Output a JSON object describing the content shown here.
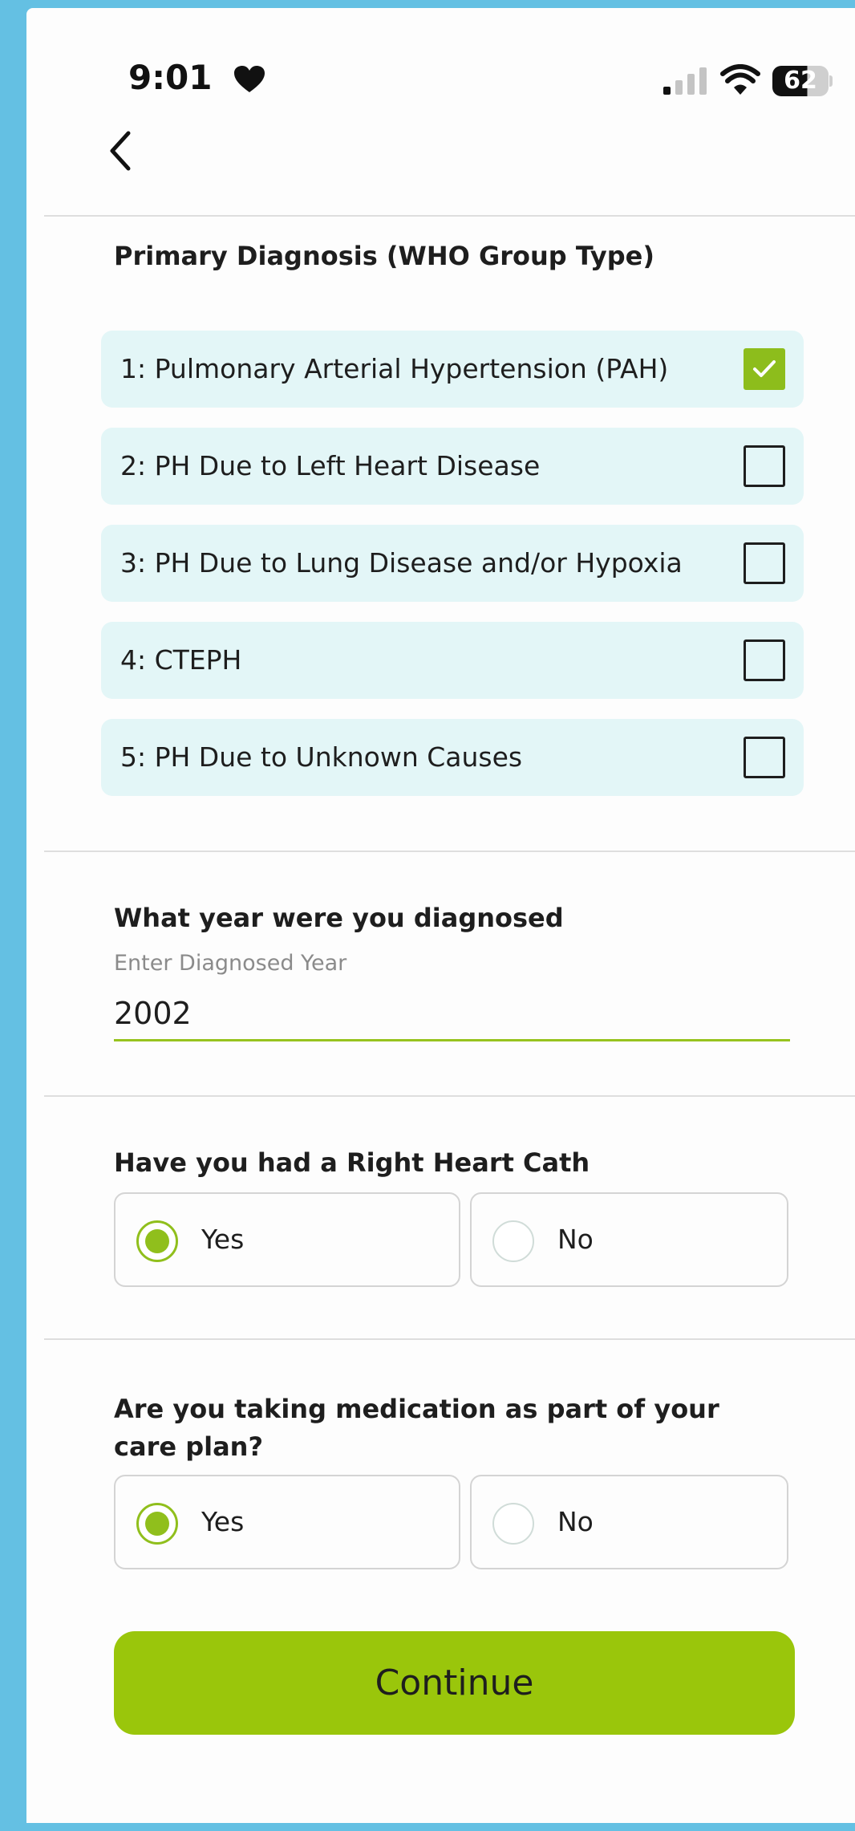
{
  "status_bar": {
    "time": "9:01",
    "battery": "62"
  },
  "colors": {
    "accent": "#9ac60b",
    "option_background": "#e3f6f7",
    "page_background": "#64c0e3"
  },
  "diagnosis": {
    "title": "Primary Diagnosis (WHO Group Type)",
    "options": [
      {
        "label": "1: Pulmonary Arterial Hypertension (PAH)",
        "checked": true
      },
      {
        "label": "2: PH Due to Left Heart Disease",
        "checked": false
      },
      {
        "label": "3: PH Due to Lung Disease and/or Hypoxia",
        "checked": false
      },
      {
        "label": "4: CTEPH",
        "checked": false
      },
      {
        "label": "5: PH Due to Unknown Causes",
        "checked": false
      }
    ]
  },
  "year": {
    "title": "What year were you diagnosed",
    "field_label": "Enter Diagnosed Year",
    "value": "2002"
  },
  "right_heart_cath": {
    "title": "Have you had a Right Heart Cath",
    "yes_label": "Yes",
    "no_label": "No",
    "selected": "Yes"
  },
  "medication": {
    "title": "Are you taking medication as part of your care plan?",
    "yes_label": "Yes",
    "no_label": "No",
    "selected": "Yes"
  },
  "continue_label": "Continue"
}
